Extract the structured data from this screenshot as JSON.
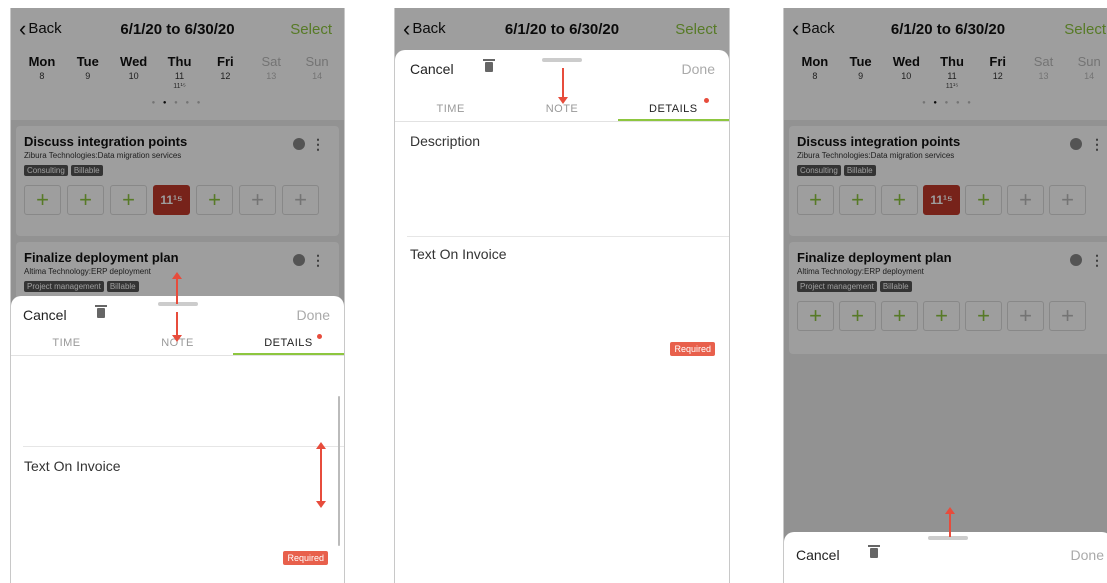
{
  "header": {
    "back_label": "Back",
    "date_range": "6/1/20 to 6/30/20",
    "select_label": "Select"
  },
  "days": [
    {
      "name": "Mon",
      "num": "8"
    },
    {
      "name": "Tue",
      "num": "9"
    },
    {
      "name": "Wed",
      "num": "10"
    },
    {
      "name": "Thu",
      "num": "11",
      "sub": "11¹⁵"
    },
    {
      "name": "Fri",
      "num": "12"
    },
    {
      "name": "Sat",
      "num": "13"
    },
    {
      "name": "Sun",
      "num": "14"
    }
  ],
  "cards": [
    {
      "title": "Discuss integration points",
      "subtitle": "Zibura Technologies:Data migration services",
      "tags": [
        "Consulting",
        "Billable"
      ],
      "highlight_value": "11¹⁵"
    },
    {
      "title": "Finalize deployment plan",
      "subtitle": "Altima Technology:ERP deployment",
      "tags": [
        "Project management",
        "Billable"
      ]
    }
  ],
  "sheet": {
    "cancel_label": "Cancel",
    "done_label": "Done",
    "tabs": [
      "TIME",
      "NOTE",
      "DETAILS"
    ],
    "description_label": "Description",
    "invoice_label": "Text On Invoice",
    "required_label": "Required"
  },
  "cell_symbol": "+",
  "colors": {
    "accent": "#8dc63f",
    "highlight": "#c0392b",
    "required": "#e8604c",
    "arrow": "#e74c3c"
  }
}
